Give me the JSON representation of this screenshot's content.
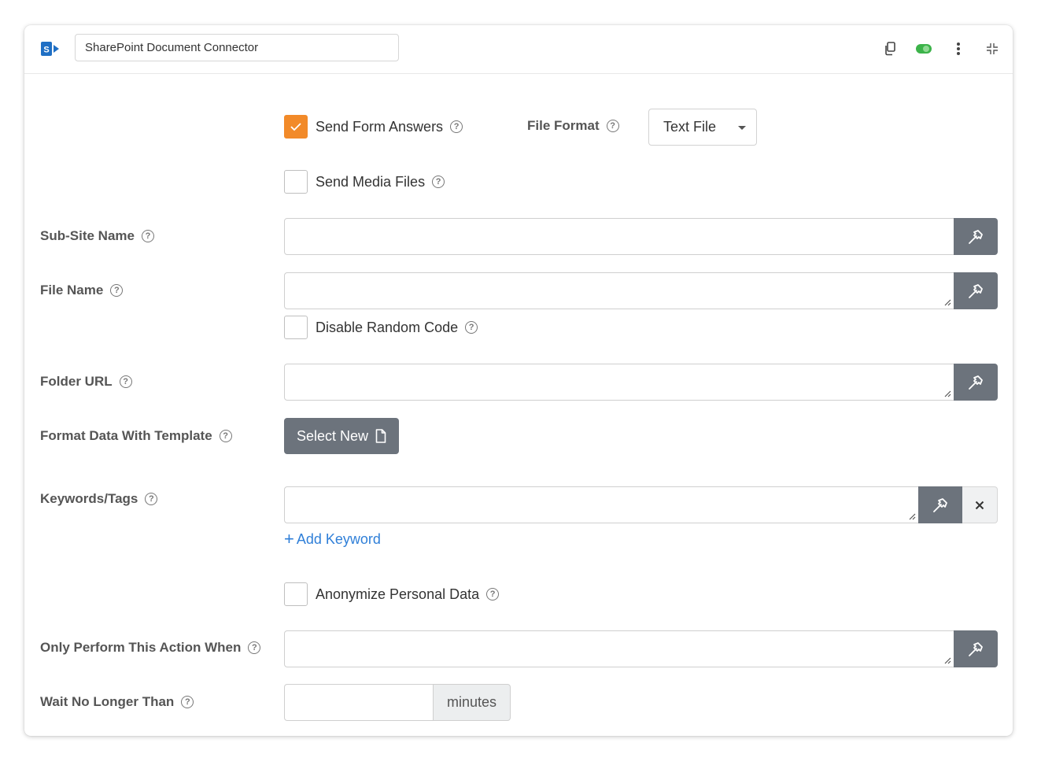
{
  "header": {
    "connector_name": "SharePoint Document Connector",
    "logo_icon": "sharepoint-logo",
    "icons": [
      "copy-icon",
      "toggle-icon",
      "more-vertical-icon",
      "collapse-icon"
    ],
    "toggle_on": true,
    "toggle_color": "#3cb34a"
  },
  "form": {
    "send_form_answers": {
      "label": "Send Form Answers",
      "checked": true
    },
    "file_format": {
      "label": "File Format",
      "value": "Text File"
    },
    "send_media_files": {
      "label": "Send Media Files",
      "checked": false
    },
    "sub_site_name": {
      "label": "Sub-Site Name"
    },
    "file_name": {
      "label": "File Name"
    },
    "disable_random_code": {
      "label": "Disable Random Code",
      "checked": false
    },
    "folder_url": {
      "label": "Folder URL"
    },
    "format_template": {
      "label": "Format Data With Template",
      "button": "Select New"
    },
    "keywords": {
      "label": "Keywords/Tags",
      "add_link": "Add Keyword",
      "add_prefix": "+"
    },
    "anonymize": {
      "label": "Anonymize Personal Data",
      "checked": false
    },
    "condition": {
      "label": "Only Perform This Action When"
    },
    "wait": {
      "label": "Wait No Longer Than",
      "unit": "minutes"
    }
  },
  "colors": {
    "accent_orange": "#f28a29",
    "tool_button": "#6c737c",
    "link_blue": "#2f7fd8"
  }
}
